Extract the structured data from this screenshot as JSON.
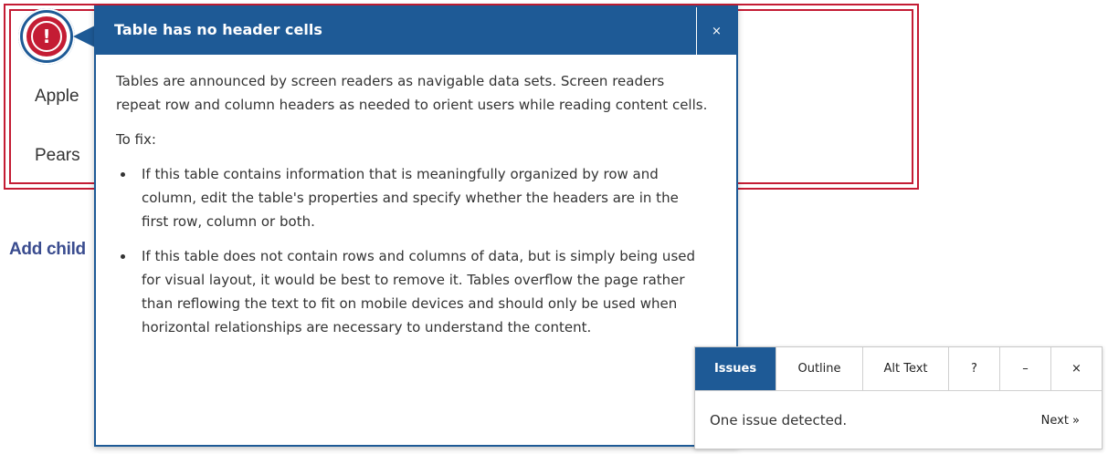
{
  "page": {
    "table_cells": [
      "Apple",
      "Pears"
    ],
    "add_child_text": "Add child"
  },
  "marker": {
    "symbol": "!",
    "icon": "error-icon"
  },
  "popup": {
    "title": "Table has no header cells",
    "close_label": "×",
    "description": "Tables are announced by screen readers as navigable data sets. Screen readers repeat row and column headers as needed to orient users while reading content cells.",
    "to_fix_label": "To fix:",
    "fixes": [
      "If this table contains information that is meaningfully organized by row and column, edit the table's properties and specify whether the headers are in the first row, column or both.",
      "If this table does not contain rows and columns of data, but is simply being used for visual layout, it would be best to remove it. Tables overflow the page rather than reflowing the text to fit on mobile devices and should only be used when horizontal relationships are necessary to understand the content."
    ]
  },
  "checker": {
    "tabs": [
      {
        "label": "Issues",
        "active": true
      },
      {
        "label": "Outline",
        "active": false
      },
      {
        "label": "Alt Text",
        "active": false
      },
      {
        "label": "?",
        "active": false
      },
      {
        "label": "–",
        "active": false
      },
      {
        "label": "×",
        "active": false
      }
    ],
    "status": "One issue detected.",
    "next_label": "Next »"
  },
  "colors": {
    "primary": "#1e5a96",
    "error": "#c41c34",
    "link": "#3a4c8f"
  }
}
